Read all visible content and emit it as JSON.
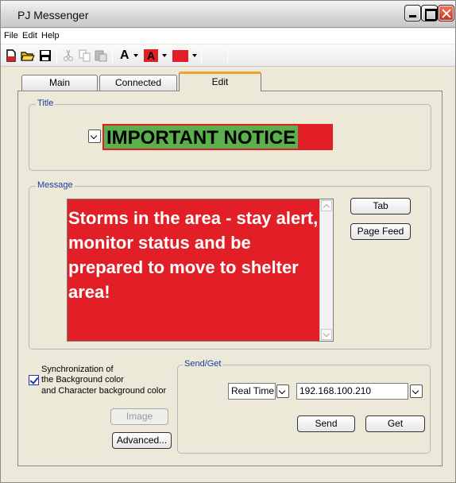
{
  "window": {
    "title": "PJ Messenger"
  },
  "menu": {
    "file": "File",
    "edit": "Edit",
    "help": "Help"
  },
  "toolbar": {
    "items": [
      "new-icon",
      "open-icon",
      "save-icon",
      "cut-icon",
      "copy-icon",
      "paste-icon",
      "font-color-icon",
      "char-background-icon",
      "background-color-icon"
    ],
    "font_letter": "A",
    "char_bg_color": "#e21f26",
    "bg_color": "#e21f26"
  },
  "tabs": [
    {
      "label": "Main"
    },
    {
      "label": "Connected"
    },
    {
      "label": "Edit",
      "active": true
    }
  ],
  "title_section": {
    "legend": "Title",
    "text": "IMPORTANT NOTICE",
    "text_bg_color": "#5ab04a",
    "bg_color": "#e21f26"
  },
  "message_section": {
    "legend": "Message",
    "text": "Storms in the area - stay alert, monitor status and be prepared to move to shelter area!",
    "bg_color": "#e21f26",
    "text_color": "#ffffff",
    "tab_button": "Tab",
    "page_feed_button": "Page Feed"
  },
  "sync": {
    "checked": true,
    "line1": "Synchronization of",
    "line2": "the Background color",
    "line3": "and Character background color"
  },
  "image_button": "Image",
  "advanced_button": "Advanced...",
  "send_get": {
    "legend": "Send/Get",
    "mode": "Real Time",
    "address": "192.168.100.210",
    "send_button": "Send",
    "get_button": "Get"
  }
}
